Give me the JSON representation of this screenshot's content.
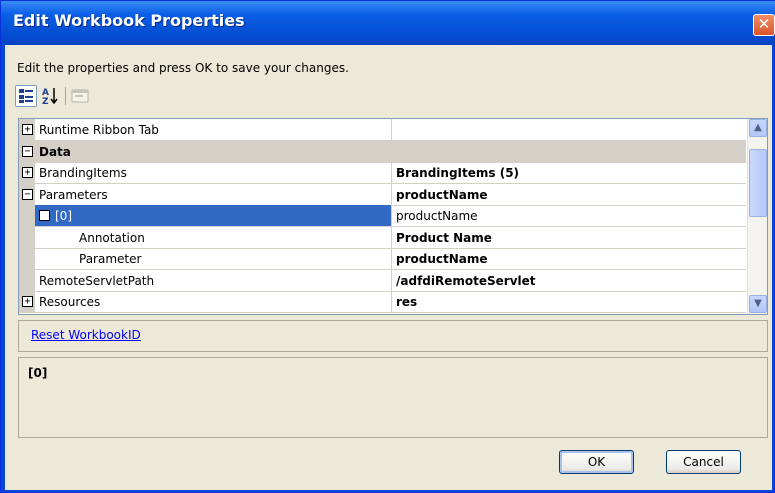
{
  "window": {
    "title": "Edit Workbook Properties",
    "close_glyph": "✕"
  },
  "instructions": "Edit the properties and press OK to save your changes.",
  "toolbar": {
    "categorized_icon": "categorized-icon",
    "alphabetical_icon": "alphabetical-icon",
    "alphabetical_glyph": "A↓",
    "property_pages_icon": "property-pages-icon"
  },
  "grid": {
    "rows": [
      {
        "name": "Runtime Ribbon Tab",
        "value": "",
        "expander": "+",
        "indent": 0,
        "kind": "property"
      },
      {
        "name": "Data",
        "value": "",
        "expander": "−",
        "indent": 0,
        "kind": "category"
      },
      {
        "name": "BrandingItems",
        "value": "BrandingItems (5)",
        "expander": "+",
        "indent": 0,
        "kind": "property",
        "value_bold": true
      },
      {
        "name": "Parameters",
        "value": "productName",
        "expander": "−",
        "indent": 0,
        "kind": "property",
        "value_bold": true
      },
      {
        "name": "[0]",
        "value": "productName",
        "expander": "−",
        "indent": 1,
        "kind": "selected",
        "value_bold": false
      },
      {
        "name": "Annotation",
        "value": "Product Name",
        "expander": "",
        "indent": 2,
        "kind": "property",
        "value_bold": true
      },
      {
        "name": "Parameter",
        "value": "productName",
        "expander": "",
        "indent": 2,
        "kind": "property",
        "value_bold": true
      },
      {
        "name": "RemoteServletPath",
        "value": "/adfdiRemoteServlet",
        "expander": "",
        "indent": 0,
        "kind": "property",
        "value_bold": true
      },
      {
        "name": "Resources",
        "value": "res",
        "expander": "+",
        "indent": 0,
        "kind": "property",
        "value_bold": true
      }
    ],
    "scroll_up_glyph": "▲",
    "scroll_down_glyph": "▼"
  },
  "commands": {
    "reset_link": "Reset WorkbookID"
  },
  "description": {
    "title": "[0]"
  },
  "buttons": {
    "ok": "OK",
    "cancel": "Cancel"
  },
  "colors": {
    "title_bar": "#0a5fe6",
    "selection": "#316ac5",
    "dialog_bg": "#ece9d8",
    "link": "#0000ff"
  }
}
